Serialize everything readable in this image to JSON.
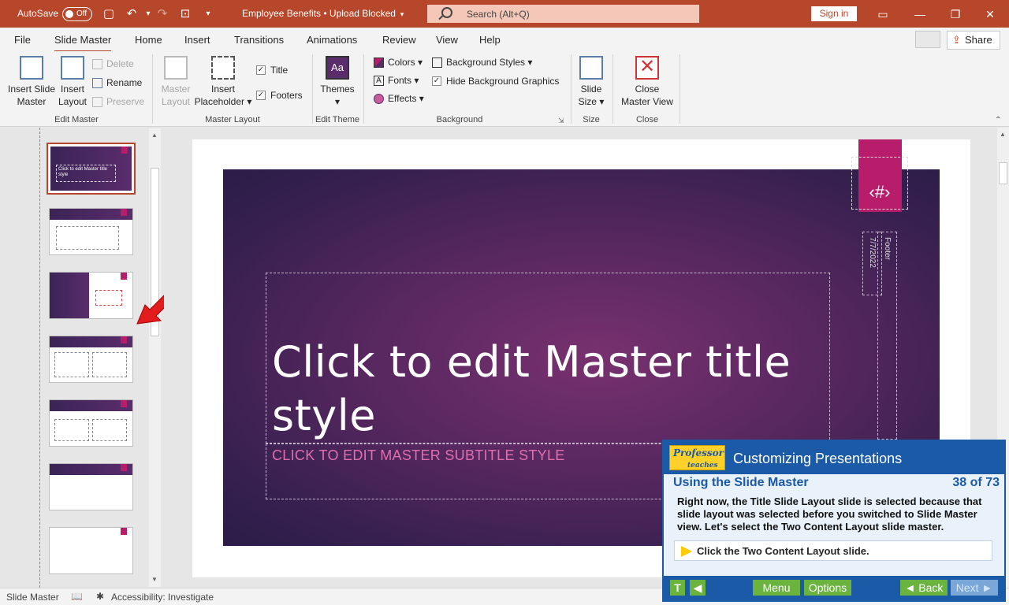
{
  "titlebar": {
    "autosave_label": "AutoSave",
    "autosave_state": "Off",
    "document_title": "Employee Benefits • Upload Blocked",
    "search_placeholder": "Search (Alt+Q)",
    "sign_in": "Sign in",
    "accent_color": "#b7472a"
  },
  "tabs": [
    {
      "label": "File"
    },
    {
      "label": "Slide Master",
      "active": true
    },
    {
      "label": "Home"
    },
    {
      "label": "Insert"
    },
    {
      "label": "Transitions"
    },
    {
      "label": "Animations"
    },
    {
      "label": "Review"
    },
    {
      "label": "View"
    },
    {
      "label": "Help"
    }
  ],
  "share_label": "Share",
  "ribbon": {
    "edit_master": {
      "label": "Edit Master",
      "insert_slide_master": "Insert Slide Master",
      "insert_layout": "Insert Layout",
      "delete": "Delete",
      "rename": "Rename",
      "preserve": "Preserve"
    },
    "master_layout": {
      "label": "Master Layout",
      "master_layout_btn": "Master Layout",
      "insert_placeholder": "Insert Placeholder",
      "title_check": "Title",
      "footers_check": "Footers"
    },
    "edit_theme": {
      "label": "Edit Theme",
      "themes": "Themes"
    },
    "background": {
      "label": "Background",
      "colors": "Colors",
      "fonts": "Fonts",
      "effects": "Effects",
      "background_styles": "Background Styles",
      "hide_bg_graphics": "Hide Background Graphics"
    },
    "size": {
      "label": "Size",
      "slide_size": "Slide Size"
    },
    "close": {
      "label": "Close",
      "close_master_view": "Close Master View"
    }
  },
  "thumb_title_text": "Click to edit Master title style",
  "slide": {
    "title": "Click to edit Master title style",
    "subtitle": "CLICK TO EDIT MASTER SUBTITLE STYLE",
    "number_placeholder": "‹#›",
    "date": "7/7/2022",
    "footer": "Footer"
  },
  "statusbar": {
    "view": "Slide Master",
    "accessibility": "Accessibility: Investigate"
  },
  "tutorial": {
    "logo_line1": "Professor",
    "logo_line2": "teaches",
    "title": "Customizing Presentations",
    "lesson": "Using the Slide Master",
    "progress": "38 of 73",
    "body": "Right now, the Title Slide Layout slide is selected because that slide layout was selected before you switched to Slide Master view. Let's select the Two Content Layout slide master.",
    "instruction": "Click the Two Content Layout slide.",
    "btn_text": "T",
    "btn_menu": "Menu",
    "btn_options": "Options",
    "btn_back": "◄ Back",
    "btn_next": "Next ►"
  }
}
